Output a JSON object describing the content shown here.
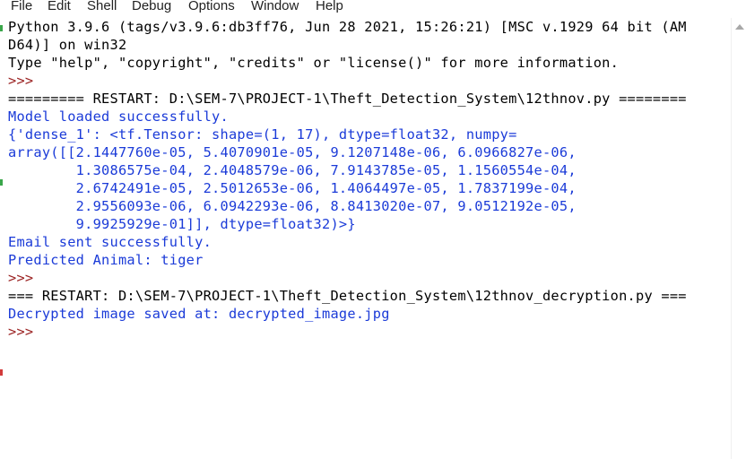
{
  "menu": [
    {
      "id": "file",
      "label": "File"
    },
    {
      "id": "edit",
      "label": "Edit"
    },
    {
      "id": "shell",
      "label": "Shell"
    },
    {
      "id": "debug",
      "label": "Debug"
    },
    {
      "id": "options",
      "label": "Options"
    },
    {
      "id": "window",
      "label": "Window"
    },
    {
      "id": "help",
      "label": "Help"
    }
  ],
  "shell_lines": [
    {
      "text": "Python 3.9.6 (tags/v3.9.6:db3ff76, Jun 28 2021, 15:26:21) [MSC v.1929 64 bit (AM",
      "kind": "stdout"
    },
    {
      "text": "D64)] on win32",
      "kind": "stdout"
    },
    {
      "text": "Type \"help\", \"copyright\", \"credits\" or \"license()\" for more information.",
      "kind": "stdout"
    },
    {
      "text": ">>> ",
      "kind": "prompt"
    },
    {
      "text": "========= RESTART: D:\\SEM-7\\PROJECT-1\\Theft_Detection_System\\12thnov.py ========",
      "kind": "stdout"
    },
    {
      "text": "Model loaded successfully.",
      "kind": "output"
    },
    {
      "text": "{'dense_1': <tf.Tensor: shape=(1, 17), dtype=float32, numpy=",
      "kind": "output"
    },
    {
      "text": "array([[2.1447760e-05, 5.4070901e-05, 9.1207148e-06, 6.0966827e-06,",
      "kind": "output"
    },
    {
      "text": "        1.3086575e-04, 2.4048579e-06, 7.9143785e-05, 1.1560554e-04,",
      "kind": "output"
    },
    {
      "text": "        2.6742491e-05, 2.5012653e-06, 1.4064497e-05, 1.7837199e-04,",
      "kind": "output"
    },
    {
      "text": "        2.9556093e-06, 6.0942293e-06, 8.8413020e-07, 9.0512192e-05,",
      "kind": "output"
    },
    {
      "text": "        9.9925929e-01]], dtype=float32)>}",
      "kind": "output"
    },
    {
      "text": "Email sent successfully.",
      "kind": "output"
    },
    {
      "text": "Predicted Animal: tiger",
      "kind": "output"
    },
    {
      "text": ">>> ",
      "kind": "prompt"
    },
    {
      "text": "=== RESTART: D:\\SEM-7\\PROJECT-1\\Theft_Detection_System\\12thnov_decryption.py ===",
      "kind": "stdout"
    },
    {
      "text": "Decrypted image saved at: decrypted_image.jpg",
      "kind": "output"
    },
    {
      "text": ">>> ",
      "kind": "prompt"
    }
  ],
  "colors": {
    "stdout": "#000000",
    "output": "#1b3bd8",
    "prompt": "#9b2222",
    "gutter_green": "#3aa64a",
    "gutter_red": "#d23b3b"
  }
}
